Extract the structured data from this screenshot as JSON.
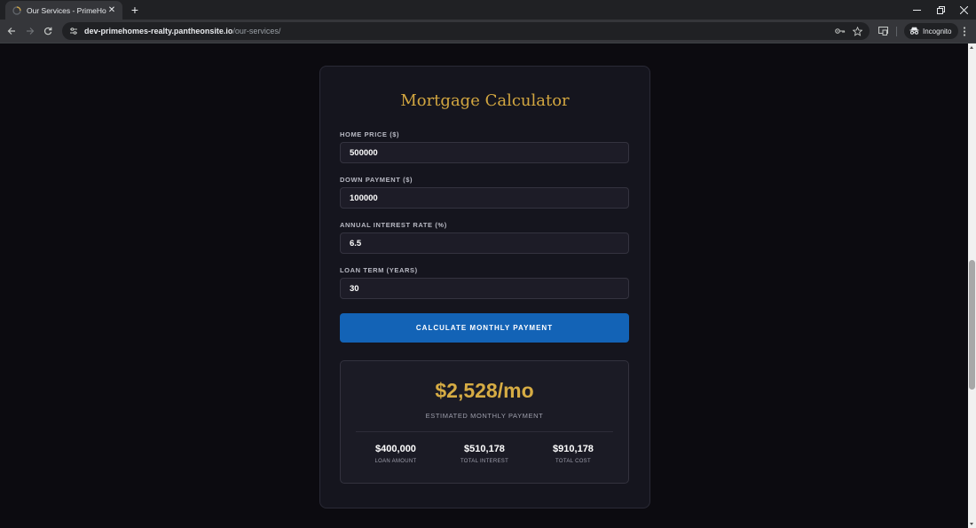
{
  "browser": {
    "tab_title": "Our Services - PrimeHomes Realty",
    "url_host": "dev-primehomes-realty.pantheonsite.io",
    "url_path": "/our-services/",
    "incognito_label": "Incognito"
  },
  "calculator": {
    "title": "Mortgage Calculator",
    "fields": [
      {
        "label": "HOME PRICE ($)",
        "value": "500000"
      },
      {
        "label": "DOWN PAYMENT ($)",
        "value": "100000"
      },
      {
        "label": "ANNUAL INTEREST RATE (%)",
        "value": "6.5"
      },
      {
        "label": "LOAN TERM (YEARS)",
        "value": "30"
      }
    ],
    "button_label": "CALCULATE MONTHLY PAYMENT",
    "result": {
      "monthly": "$2,528/mo",
      "monthly_label": "ESTIMATED MONTHLY PAYMENT",
      "stats": [
        {
          "value": "$400,000",
          "label": "LOAN AMOUNT"
        },
        {
          "value": "$510,178",
          "label": "TOTAL INTEREST"
        },
        {
          "value": "$910,178",
          "label": "TOTAL COST"
        }
      ]
    }
  },
  "colors": {
    "accent_gold": "#d2a640",
    "button_blue": "#1363b6",
    "page_bg": "#0c0b10",
    "card_bg": "#15151e"
  }
}
